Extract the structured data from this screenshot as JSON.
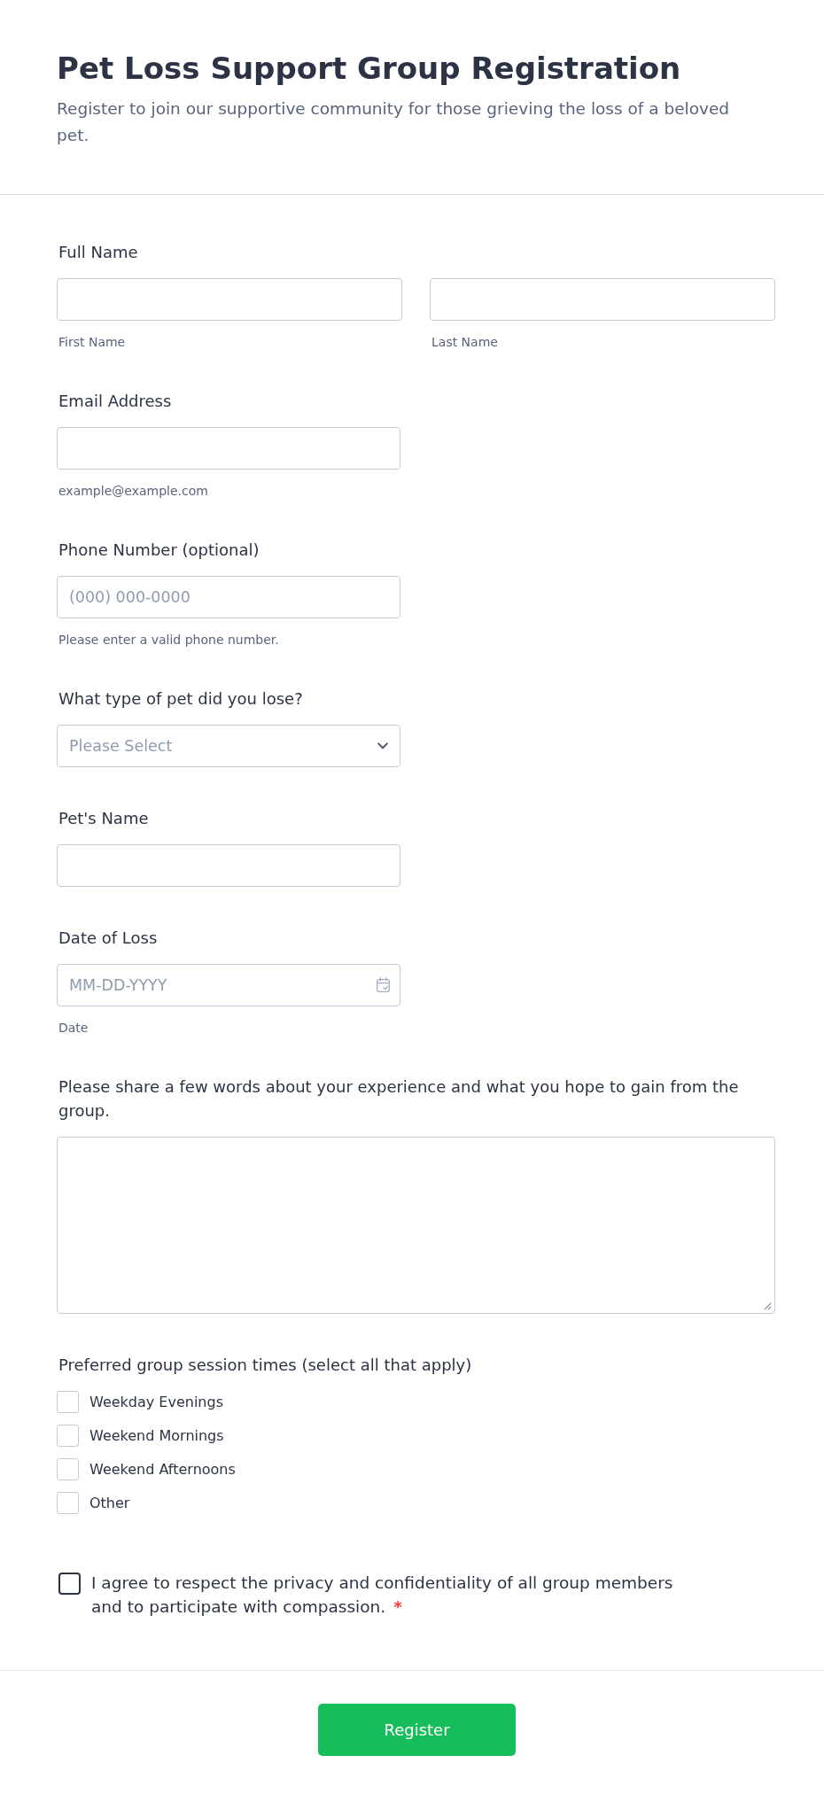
{
  "header": {
    "title": "Pet Loss Support Group Registration",
    "subtitle": "Register to join our supportive community for those grieving the loss of a beloved pet."
  },
  "fields": [
    {
      "kind": "name",
      "label": "Full Name",
      "parts": [
        {
          "sublabel": "First Name"
        },
        {
          "sublabel": "Last Name"
        }
      ]
    },
    {
      "kind": "text",
      "label": "Email Address",
      "sublabel": "example@example.com"
    },
    {
      "kind": "text",
      "label": "Phone Number (optional)",
      "placeholder": "(000) 000-0000",
      "sublabel": "Please enter a valid phone number."
    },
    {
      "kind": "dropdown",
      "label": "What type of pet did you lose?",
      "placeholder": "Please Select"
    },
    {
      "kind": "text",
      "label": "Pet's Name"
    },
    {
      "kind": "date",
      "label": "Date of Loss",
      "placeholder": "MM-DD-YYYY",
      "sublabel": "Date"
    },
    {
      "kind": "textarea",
      "label": "Please share a few words about your experience and what you hope to gain from the group."
    },
    {
      "kind": "checkboxes",
      "label": "Preferred group session times (select all that apply)",
      "options": [
        {
          "label": "Weekday Evenings",
          "checked": false
        },
        {
          "label": "Weekend Mornings",
          "checked": false
        },
        {
          "label": "Weekend Afternoons",
          "checked": false
        },
        {
          "label": "Other",
          "checked": false
        }
      ]
    }
  ],
  "agreement": {
    "text": "I agree to respect the privacy and confidentiality of all group members and to participate with compassion.",
    "checked": false,
    "required_mark": "*"
  },
  "submit": {
    "label": "Register"
  }
}
